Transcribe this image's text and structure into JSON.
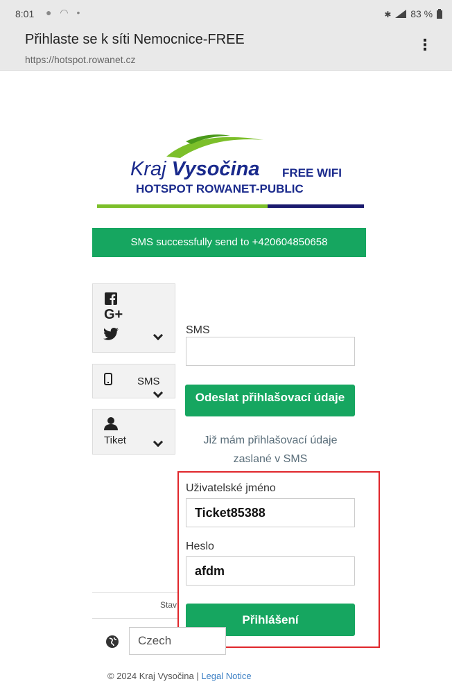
{
  "status_bar": {
    "time": "8:01",
    "notification_icons": "● ◠ •",
    "battery": "83 %"
  },
  "browser": {
    "title": "Přihlaste se k síti Nemocnice-FREE",
    "url": "https://hotspot.rowanet.cz",
    "menu_glyph": "⋮"
  },
  "logo": {
    "brand_kraj": "Kraj",
    "brand_vysocina": "Vysočina",
    "free_wifi": "FREE WIFI",
    "hotspot": "HOTSPOT ROWANET-PUBLIC",
    "colors": {
      "green": "#7cbf2a",
      "blue": "#1a2a8c"
    }
  },
  "alert": {
    "text": "SMS successfully send to +420604850658",
    "color": "#16a660"
  },
  "tabs": {
    "social_icons": [
      "facebook-icon",
      "google-plus-icon",
      "twitter-icon"
    ],
    "sms_label": "SMS",
    "ticket_label": "Tiket"
  },
  "sms_form": {
    "label": "SMS",
    "value": "",
    "send_button": "Odeslat přihlašovací údaje",
    "have_credentials_link": "Již mám přihlašovací údaje zaslané v SMS"
  },
  "login_form": {
    "username_label": "Uživatelské jméno",
    "username_value": "Ticket85388",
    "password_label": "Heslo",
    "password_value": "afdm",
    "login_button": "Přihlášení",
    "highlight_color": "#e0262b"
  },
  "status_partial": "Stav",
  "language": {
    "selected": "Czech"
  },
  "footer": {
    "copyright": "© 2024 Kraj Vysočina | ",
    "legal_link": "Legal Notice"
  }
}
